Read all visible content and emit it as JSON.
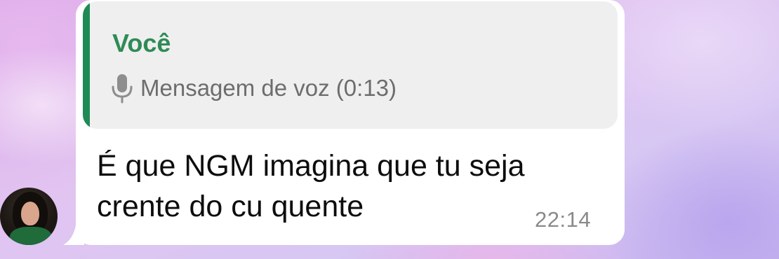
{
  "chat": {
    "message": {
      "reply_to": {
        "author": "Você",
        "icon": "microphone-icon",
        "preview": "Mensagem de voz (0:13)"
      },
      "text": "É que NGM imagina que tu seja crente do cu quente",
      "time": "22:14"
    }
  },
  "colors": {
    "quote_accent": "#1e8a55",
    "quote_author": "#2e8b57",
    "bubble_bg": "#ffffff",
    "quote_bg": "#efefef"
  }
}
